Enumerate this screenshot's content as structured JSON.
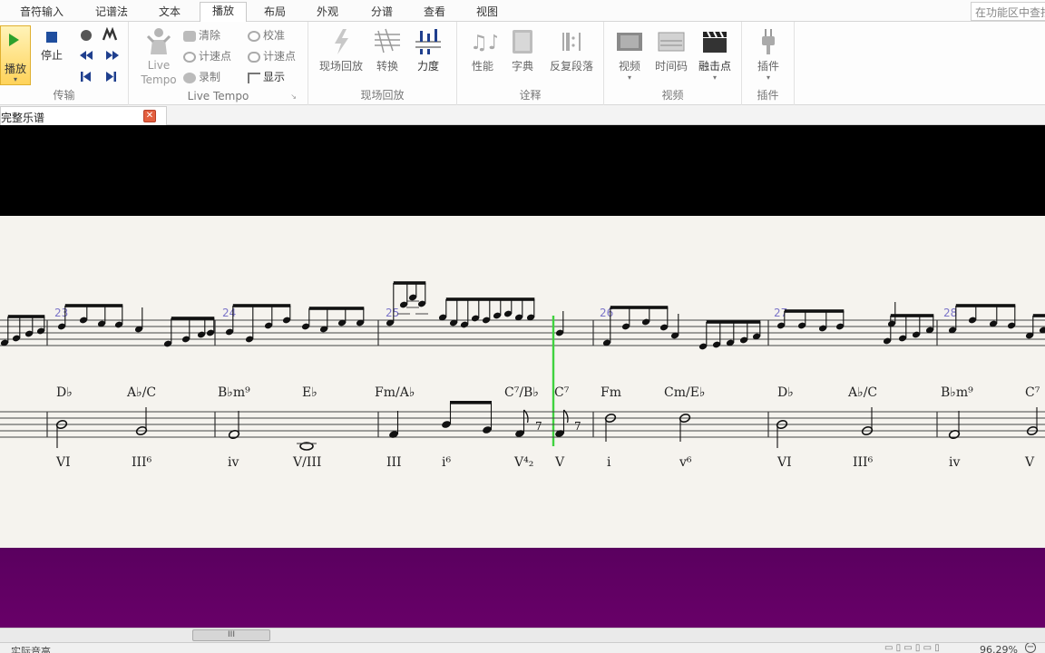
{
  "tabs": [
    "音符输入",
    "记谱法",
    "文本",
    "播放",
    "布局",
    "外观",
    "分谱",
    "查看",
    "视图"
  ],
  "active_tab": "播放",
  "search_placeholder": "在功能区中查找",
  "ribbon": {
    "transport": {
      "play": "播放",
      "stop": "停止",
      "group": "传输"
    },
    "live_tempo": {
      "button": "Live\nTempo",
      "clear": "清除",
      "tap_points": "计速点",
      "record": "录制",
      "calibrate": "校准",
      "tap_points2": "计速点",
      "show": "显示",
      "group": "Live Tempo"
    },
    "live_playback": {
      "live_playback": "现场回放",
      "transform": "转换",
      "velocity": "力度",
      "group": "现场回放"
    },
    "interpretation": {
      "performance": "性能",
      "dictionary": "字典",
      "repeats": "反复段落",
      "group": "诠释"
    },
    "video": {
      "video": "视频",
      "timecode": "时间码",
      "hitpoints": "融击点",
      "group": "视频"
    },
    "plugins": {
      "plugins": "插件",
      "group": "插件"
    }
  },
  "document_tab": "完整乐谱",
  "score": {
    "measures": [
      "23",
      "24",
      "25",
      "26",
      "27",
      "28"
    ],
    "chords": [
      "D♭",
      "A♭/C",
      "B♭m⁹",
      "E♭",
      "Fm/A♭",
      "C⁷/B♭",
      "C⁷",
      "Fm",
      "Cm/E♭",
      "D♭",
      "A♭/C",
      "B♭m⁹",
      "C⁷"
    ],
    "roman": [
      "VI",
      "III⁶",
      "iv",
      "V/III",
      "III",
      "i⁶",
      "V⁴₂",
      "V",
      "i",
      "v⁶",
      "VI",
      "III⁶",
      "iv",
      "V"
    ]
  },
  "colors": {
    "playback_line": "#3fd23f",
    "measure_number": "#7b74c9",
    "purple_band": "#660066"
  },
  "status": {
    "left": "实际音高",
    "zoom": "96.29%"
  },
  "scroll_thumb": "III"
}
